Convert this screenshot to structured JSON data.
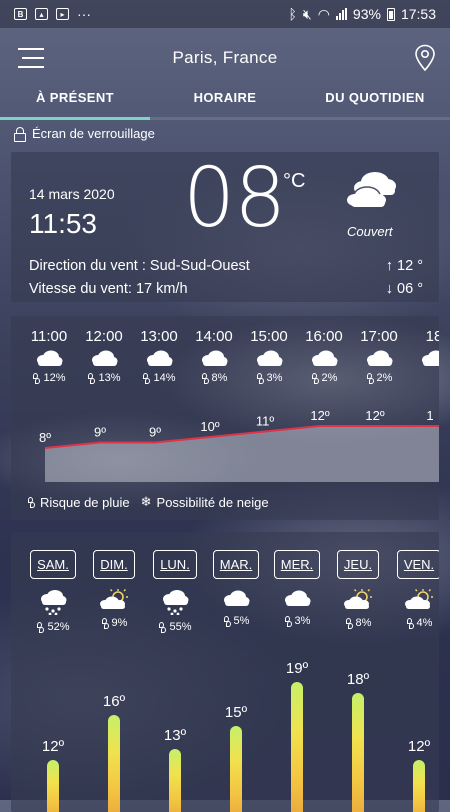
{
  "status_bar": {
    "battery": "93%",
    "time": "17:53",
    "overflow": "···"
  },
  "app_bar": {
    "city": "Paris, France"
  },
  "tabs": [
    {
      "label": "À PRÉSENT",
      "active": true
    },
    {
      "label": "HORAIRE",
      "active": false
    },
    {
      "label": "DU QUOTIDIEN",
      "active": false
    }
  ],
  "lock_screen_label": "Écran de verrouillage",
  "current": {
    "date": "14 mars 2020",
    "time": "11:53",
    "temperature": "08",
    "unit": "°C",
    "condition": "Couvert",
    "condition_icon": "cloudy-icon",
    "wind_direction": "Direction du vent : Sud-Sud-Ouest",
    "wind_speed": "Vitesse du vent: 17 km/h",
    "temp_max": "↑ 12 °",
    "temp_min": "↓ 06 °"
  },
  "hourly": {
    "hours": [
      {
        "time": "11:00",
        "rain": "12%",
        "temp": "8º",
        "t": 8
      },
      {
        "time": "12:00",
        "rain": "13%",
        "temp": "9º",
        "t": 9
      },
      {
        "time": "13:00",
        "rain": "14%",
        "temp": "9º",
        "t": 9
      },
      {
        "time": "14:00",
        "rain": "8%",
        "temp": "10º",
        "t": 10
      },
      {
        "time": "15:00",
        "rain": "3%",
        "temp": "11º",
        "t": 11
      },
      {
        "time": "16:00",
        "rain": "2%",
        "temp": "12º",
        "t": 12
      },
      {
        "time": "17:00",
        "rain": "2%",
        "temp": "12º",
        "t": 12
      },
      {
        "time": "18",
        "rain": "",
        "temp": "1",
        "t": 12
      }
    ],
    "legend_rain": "Risque de pluie",
    "legend_snow": "Possibilité de neige",
    "line_color": "#e0334a"
  },
  "daily": {
    "days": [
      {
        "label": "SAM.",
        "rain": "52%",
        "icon": "rain-cloud-icon",
        "max": "12º",
        "max_v": 12
      },
      {
        "label": "DIM.",
        "rain": "9%",
        "icon": "sun-cloud-icon",
        "max": "16º",
        "max_v": 16
      },
      {
        "label": "LUN.",
        "rain": "55%",
        "icon": "rain-cloud-icon",
        "max": "13º",
        "max_v": 13
      },
      {
        "label": "MAR.",
        "rain": "5%",
        "icon": "cloud-icon",
        "max": "15º",
        "max_v": 15
      },
      {
        "label": "MER.",
        "rain": "3%",
        "icon": "cloud-icon",
        "max": "19º",
        "max_v": 19
      },
      {
        "label": "JEU.",
        "rain": "8%",
        "icon": "sun-cloud-icon",
        "max": "18º",
        "max_v": 18
      },
      {
        "label": "VEN.",
        "rain": "4%",
        "icon": "sun-cloud-icon",
        "max": "12º",
        "max_v": 12
      }
    ]
  }
}
